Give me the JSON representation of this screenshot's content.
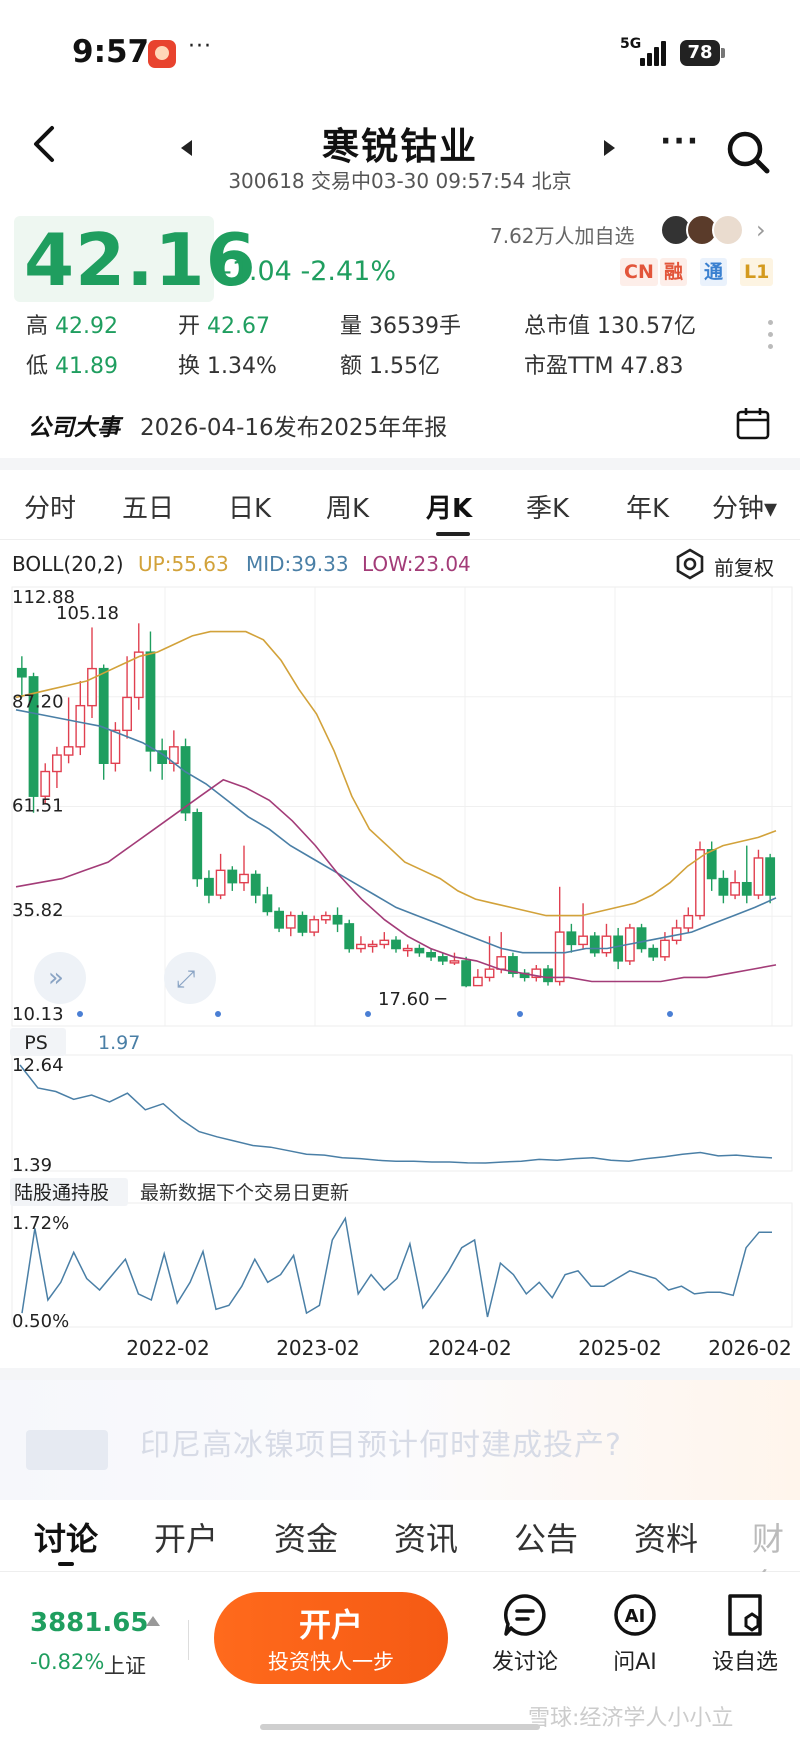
{
  "status": {
    "time": "9:57",
    "dots": "···",
    "network": "5G",
    "battery": "78"
  },
  "nav": {
    "title": "寒锐钴业",
    "subtitle": "300618 交易中03-30 09:57:54 北京"
  },
  "quote": {
    "price": "42.16",
    "change": "-1.04",
    "change_pct": "-2.41%",
    "followers": "7.62万人加自选",
    "tags": [
      "CN",
      "融",
      "通",
      "L1"
    ],
    "stats": {
      "high_label": "高",
      "high": "42.92",
      "low_label": "低",
      "low": "41.89",
      "open_label": "开",
      "open": "42.67",
      "turnover_label": "换",
      "turnover": "1.34%",
      "volume_label": "量",
      "volume": "36539手",
      "amount_label": "额",
      "amount": "1.55亿",
      "mktcap_label": "总市值",
      "mktcap": "130.57亿",
      "pe_label": "市盈TTM",
      "pe": "47.83"
    }
  },
  "event": {
    "title": "公司大事",
    "text": "2026-04-16发布2025年年报"
  },
  "tabs": [
    "分时",
    "五日",
    "日K",
    "周K",
    "月K",
    "季K",
    "年K",
    "分钟▾"
  ],
  "active_tab": 4,
  "colors": {
    "up": "#e04050",
    "down": "#1f9e5f",
    "boll_up": "#d2a23a",
    "boll_mid": "#4a7fa6",
    "boll_low": "#a33c78",
    "accent": "#f55a14"
  },
  "boll": {
    "label": "BOLL(20,2)",
    "up": "UP:55.63",
    "mid": "MID:39.33",
    "low": "LOW:23.04",
    "restore": "前复权"
  },
  "chart_data": [
    {
      "type": "candlestick",
      "title": "",
      "y_ticks": [
        "112.88",
        "87.20",
        "61.51",
        "35.82",
        "10.13"
      ],
      "ylim": [
        10.13,
        112.88
      ],
      "annotations": {
        "max": "105.18",
        "min": "17.60"
      },
      "x_ticks": [
        "2022-02",
        "2023-02",
        "2024-02",
        "2025-02",
        "2026-02"
      ],
      "candles": [
        [
          95,
          93,
          98,
          88
        ],
        [
          93,
          64,
          94,
          60
        ],
        [
          64,
          70,
          72,
          62
        ],
        [
          70,
          74,
          76,
          66
        ],
        [
          74,
          76,
          88,
          72
        ],
        [
          76,
          86,
          92,
          74
        ],
        [
          86,
          95,
          105,
          83
        ],
        [
          95,
          72,
          96,
          68
        ],
        [
          72,
          80,
          82,
          70
        ],
        [
          80,
          88,
          98,
          78
        ],
        [
          88,
          99,
          106,
          85
        ],
        [
          99,
          75,
          104,
          70
        ],
        [
          75,
          72,
          78,
          68
        ],
        [
          72,
          76,
          80,
          70
        ],
        [
          76,
          60,
          78,
          58
        ],
        [
          60,
          44,
          61,
          42
        ],
        [
          44,
          40,
          46,
          38
        ],
        [
          40,
          46,
          50,
          39
        ],
        [
          46,
          43,
          47,
          41
        ],
        [
          43,
          45,
          52,
          41
        ],
        [
          45,
          40,
          46,
          38
        ],
        [
          40,
          36,
          42,
          35
        ],
        [
          36,
          32,
          37,
          31
        ],
        [
          32,
          35,
          36,
          30
        ],
        [
          35,
          31,
          36,
          30
        ],
        [
          31,
          34,
          35,
          30
        ],
        [
          34,
          35,
          36,
          33
        ],
        [
          35,
          33,
          37,
          31
        ],
        [
          33,
          27,
          34,
          26
        ],
        [
          27,
          28,
          30,
          26
        ],
        [
          28,
          28,
          29,
          26
        ],
        [
          28,
          29,
          31,
          27
        ],
        [
          29,
          27,
          30,
          26
        ],
        [
          27,
          27,
          28,
          25
        ],
        [
          27,
          26,
          28,
          25
        ],
        [
          26,
          25,
          27,
          24
        ],
        [
          25,
          24,
          26,
          23
        ],
        [
          24,
          24,
          26,
          23
        ],
        [
          24,
          18,
          25,
          17.6
        ],
        [
          18,
          20,
          22,
          18
        ],
        [
          20,
          22,
          30,
          19
        ],
        [
          22,
          25,
          31,
          21
        ],
        [
          25,
          21,
          26,
          20
        ],
        [
          21,
          20,
          22,
          19
        ],
        [
          20,
          22,
          23,
          19
        ],
        [
          22,
          19,
          23,
          18
        ],
        [
          19,
          31,
          42,
          18
        ],
        [
          31,
          28,
          33,
          26
        ],
        [
          28,
          30,
          38,
          27
        ],
        [
          30,
          26,
          31,
          25
        ],
        [
          26,
          30,
          33,
          25
        ],
        [
          30,
          24,
          32,
          22
        ],
        [
          24,
          32,
          33,
          23
        ],
        [
          32,
          27,
          33,
          26
        ],
        [
          27,
          25,
          28,
          24
        ],
        [
          25,
          29,
          31,
          24
        ],
        [
          29,
          32,
          34,
          28
        ],
        [
          32,
          35,
          37,
          31
        ],
        [
          35,
          51,
          53,
          34
        ],
        [
          51,
          44,
          53,
          41
        ],
        [
          44,
          40,
          46,
          38
        ],
        [
          40,
          43,
          46,
          39
        ],
        [
          43,
          40,
          52,
          38
        ],
        [
          40,
          49,
          51,
          39
        ],
        [
          49,
          40,
          50,
          38
        ]
      ],
      "boll_up": [
        88,
        89,
        90,
        91,
        92,
        94,
        96,
        98,
        99,
        101,
        103,
        104,
        104,
        104,
        102,
        97,
        90,
        84,
        75,
        64,
        56,
        52,
        48,
        46,
        44,
        41,
        39,
        38,
        37,
        36,
        35,
        35,
        35,
        36,
        37,
        38,
        40,
        43,
        47,
        50,
        52,
        53,
        54,
        55.6
      ],
      "boll_mid": [
        85,
        84,
        83,
        82,
        81,
        79,
        77,
        74,
        70,
        67,
        63,
        59,
        56,
        52,
        49,
        46,
        43,
        40,
        37,
        35,
        33,
        31,
        29,
        27,
        26,
        26,
        26,
        27,
        27,
        28,
        29,
        30,
        31,
        33,
        35,
        37,
        39.3
      ],
      "boll_low": [
        42,
        43,
        44,
        46,
        48,
        52,
        56,
        60,
        64,
        68,
        66,
        63,
        58,
        52,
        45,
        39,
        34,
        30,
        27,
        25,
        24,
        22,
        21,
        20,
        20,
        19,
        19,
        19,
        19,
        20,
        20,
        21,
        22,
        23.04
      ]
    },
    {
      "type": "line",
      "title": "",
      "series_name": "PS",
      "current": "1.97",
      "y_ticks": [
        "12.64",
        "1.39"
      ],
      "ylim": [
        1.39,
        12.64
      ],
      "values": [
        12.64,
        10.0,
        9.6,
        8.7,
        9.2,
        8.4,
        9.4,
        7.5,
        8.2,
        6.4,
        5.0,
        4.4,
        3.9,
        3.4,
        3.2,
        2.8,
        2.4,
        2.3,
        2.0,
        1.9,
        1.7,
        1.6,
        1.6,
        1.5,
        1.5,
        1.4,
        1.39,
        1.5,
        1.6,
        1.8,
        1.7,
        1.9,
        2.0,
        1.7,
        1.6,
        1.9,
        2.1,
        2.4,
        2.6,
        2.2,
        2.3,
        2.1,
        1.97
      ]
    },
    {
      "type": "line",
      "title": "",
      "series_name": "陆股通持股",
      "note": "最新数据下个交易日更新",
      "y_ticks": [
        "1.72%",
        "0.50%"
      ],
      "ylim": [
        0.5,
        1.72
      ],
      "values": [
        0.55,
        1.65,
        0.72,
        0.95,
        1.34,
        1.0,
        0.85,
        1.05,
        1.25,
        0.8,
        0.72,
        1.32,
        0.68,
        0.95,
        1.35,
        0.6,
        0.65,
        0.9,
        1.25,
        0.95,
        1.05,
        1.3,
        0.55,
        0.65,
        1.5,
        1.78,
        0.8,
        1.05,
        0.85,
        1.0,
        1.45,
        0.62,
        0.85,
        1.1,
        1.4,
        1.5,
        0.5,
        1.2,
        1.05,
        0.8,
        0.95,
        0.75,
        1.05,
        1.1,
        0.9,
        0.9,
        1.0,
        1.1,
        1.05,
        1.0,
        0.85,
        0.9,
        0.8,
        0.82,
        0.82,
        0.78,
        1.4,
        1.6,
        1.6
      ],
      "x_ticks": [
        "2022-02",
        "2023-02",
        "2024-02",
        "2025-02",
        "2026-02"
      ]
    }
  ],
  "banner": {
    "text": "印尼高冰镍项目预计何时建成投产?"
  },
  "bottom_tabs": [
    "讨论",
    "开户",
    "资金",
    "资讯",
    "公告",
    "资料",
    "财务"
  ],
  "footer": {
    "index_value": "3881.65",
    "index_change": "-0.82%",
    "index_name": "上证",
    "open_title": "开户",
    "open_sub": "投资快人一步",
    "actions": [
      "发讨论",
      "问AI",
      "设自选"
    ],
    "watermark": "雪球:经济学人小小立"
  }
}
